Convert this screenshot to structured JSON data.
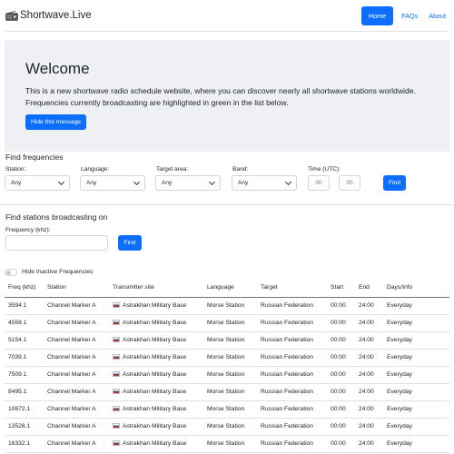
{
  "brand": {
    "name": "Shortwave.Live",
    "icon": "radio-icon"
  },
  "nav": {
    "home": "Home",
    "faqs": "FAQs",
    "about": "About"
  },
  "hero": {
    "title": "Welcome",
    "text": "This is a new shortwave radio schedule website, where you can discover nearly all shortwave stations worldwide. Frequencies currently broadcasting are highlighted in green in the list below.",
    "hide_button": "Hide this message"
  },
  "find_frequencies": {
    "title": "Find frequencies",
    "station_label": "Station:",
    "station_value": "Any",
    "language_label": "Language:",
    "language_value": "Any",
    "target_label": "Target area:",
    "target_value": "Any",
    "band_label": "Band:",
    "band_value": "Any",
    "time_label": "Time (UTC):",
    "time_hour_placeholder": "00",
    "time_min_placeholder": "00",
    "find_button": "Find"
  },
  "find_stations": {
    "title": "Find stations broadcasting on",
    "freq_label": "Frequency (khz):",
    "freq_value": "",
    "find_button": "Find"
  },
  "toggle": {
    "label": "Hide Inactive Frequencies",
    "checked": false
  },
  "table": {
    "headers": [
      "Freq (khz)",
      "Station",
      "Transmitter site",
      "Language",
      "Target",
      "Start",
      "End",
      "Days/Info"
    ],
    "rows": [
      [
        "3594.1",
        "Channel Marker A",
        "Astrakhan Military Base",
        "Morse Station",
        "Russian Federation",
        "00:00",
        "24:00",
        "Everyday"
      ],
      [
        "4558.1",
        "Channel Marker A",
        "Astrakhan Military Base",
        "Morse Station",
        "Russian Federation",
        "00:00",
        "24:00",
        "Everyday"
      ],
      [
        "5154.1",
        "Channel Marker A",
        "Astrakhan Military Base",
        "Morse Station",
        "Russian Federation",
        "00:00",
        "24:00",
        "Everyday"
      ],
      [
        "7039.1",
        "Channel Marker A",
        "Astrakhan Military Base",
        "Morse Station",
        "Russian Federation",
        "00:00",
        "24:00",
        "Everyday"
      ],
      [
        "7509.1",
        "Channel Marker A",
        "Astrakhan Military Base",
        "Morse Station",
        "Russian Federation",
        "00:00",
        "24:00",
        "Everyday"
      ],
      [
        "8495.1",
        "Channel Marker A",
        "Astrakhan Military Base",
        "Morse Station",
        "Russian Federation",
        "00:00",
        "24:00",
        "Everyday"
      ],
      [
        "10872.1",
        "Channel Marker A",
        "Astrakhan Military Base",
        "Morse Station",
        "Russian Federation",
        "00:00",
        "24:00",
        "Everyday"
      ],
      [
        "13528.1",
        "Channel Marker A",
        "Astrakhan Military Base",
        "Morse Station",
        "Russian Federation",
        "00:00",
        "24:00",
        "Everyday"
      ],
      [
        "16332.1",
        "Channel Marker A",
        "Astrakhan Military Base",
        "Morse Station",
        "Russian Federation",
        "00:00",
        "24:00",
        "Everyday"
      ]
    ]
  },
  "colors": {
    "primary": "#0d6efd",
    "hero_bg": "#eef0f3",
    "text": "#212529"
  }
}
